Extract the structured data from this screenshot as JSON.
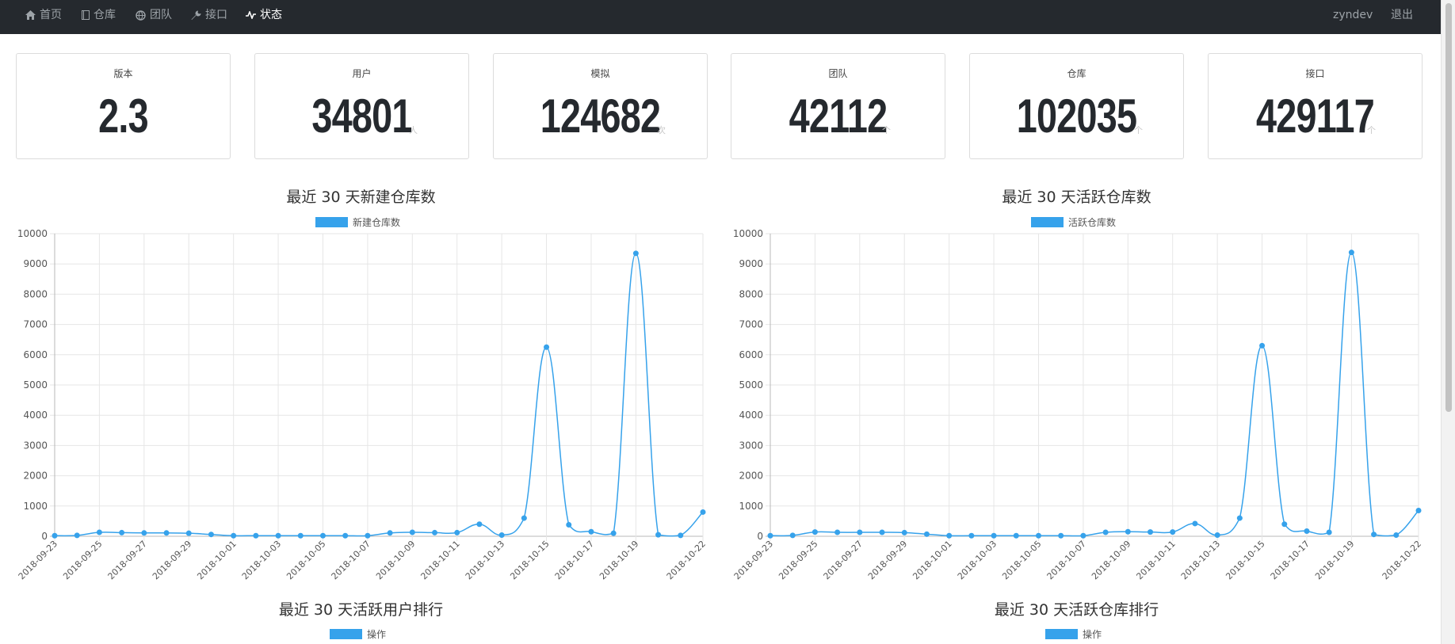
{
  "nav": {
    "items": [
      {
        "label": "首页",
        "icon": "home-icon"
      },
      {
        "label": "仓库",
        "icon": "book-icon"
      },
      {
        "label": "团队",
        "icon": "globe-icon"
      },
      {
        "label": "接口",
        "icon": "wrench-icon"
      },
      {
        "label": "状态",
        "icon": "pulse-icon",
        "active": true
      }
    ],
    "user": "zyndev",
    "logout": "退出"
  },
  "stats": [
    {
      "label": "版本",
      "value": "2.3",
      "unit": ""
    },
    {
      "label": "用户",
      "value": "34801",
      "unit": "人"
    },
    {
      "label": "模拟",
      "value": "124682",
      "unit": "次"
    },
    {
      "label": "团队",
      "value": "42112",
      "unit": "个"
    },
    {
      "label": "仓库",
      "value": "102035",
      "unit": "个"
    },
    {
      "label": "接口",
      "value": "429117",
      "unit": "个"
    }
  ],
  "bottom": {
    "left_title": "最近 30 天活跃用户排行",
    "right_title": "最近 30 天活跃仓库排行",
    "legend": "操作"
  },
  "chart_data": [
    {
      "type": "line",
      "title": "最近 30 天新建仓库数",
      "ylim": [
        0,
        10000
      ],
      "yticks": [
        0,
        1000,
        2000,
        3000,
        4000,
        5000,
        6000,
        7000,
        8000,
        9000,
        10000
      ],
      "x": [
        "2018-09-23",
        "2018-09-24",
        "2018-09-25",
        "2018-09-26",
        "2018-09-27",
        "2018-09-28",
        "2018-09-29",
        "2018-09-30",
        "2018-10-01",
        "2018-10-02",
        "2018-10-03",
        "2018-10-04",
        "2018-10-05",
        "2018-10-06",
        "2018-10-07",
        "2018-10-08",
        "2018-10-09",
        "2018-10-10",
        "2018-10-11",
        "2018-10-12",
        "2018-10-13",
        "2018-10-14",
        "2018-10-15",
        "2018-10-16",
        "2018-10-17",
        "2018-10-18",
        "2018-10-19",
        "2018-10-20",
        "2018-10-21",
        "2018-10-22"
      ],
      "xticks": [
        "2018-09-23",
        "2018-09-25",
        "2018-09-27",
        "2018-09-29",
        "2018-10-01",
        "2018-10-03",
        "2018-10-05",
        "2018-10-07",
        "2018-10-09",
        "2018-10-11",
        "2018-10-13",
        "2018-10-15",
        "2018-10-17",
        "2018-10-19",
        "2018-10-22"
      ],
      "grid": true,
      "legend_position": "top",
      "series": [
        {
          "name": "新建仓库数",
          "color": "#36a2eb",
          "values": [
            20,
            30,
            130,
            120,
            110,
            110,
            100,
            60,
            20,
            20,
            20,
            20,
            20,
            20,
            20,
            110,
            130,
            120,
            120,
            400,
            40,
            600,
            6250,
            380,
            150,
            100,
            9350,
            50,
            30,
            800
          ]
        }
      ]
    },
    {
      "type": "line",
      "title": "最近 30 天活跃仓库数",
      "ylim": [
        0,
        10000
      ],
      "yticks": [
        0,
        1000,
        2000,
        3000,
        4000,
        5000,
        6000,
        7000,
        8000,
        9000,
        10000
      ],
      "x": [
        "2018-09-23",
        "2018-09-24",
        "2018-09-25",
        "2018-09-26",
        "2018-09-27",
        "2018-09-28",
        "2018-09-29",
        "2018-09-30",
        "2018-10-01",
        "2018-10-02",
        "2018-10-03",
        "2018-10-04",
        "2018-10-05",
        "2018-10-06",
        "2018-10-07",
        "2018-10-08",
        "2018-10-09",
        "2018-10-10",
        "2018-10-11",
        "2018-10-12",
        "2018-10-13",
        "2018-10-14",
        "2018-10-15",
        "2018-10-16",
        "2018-10-17",
        "2018-10-18",
        "2018-10-19",
        "2018-10-20",
        "2018-10-21",
        "2018-10-22"
      ],
      "xticks": [
        "2018-09-23",
        "2018-09-25",
        "2018-09-27",
        "2018-09-29",
        "2018-10-01",
        "2018-10-03",
        "2018-10-05",
        "2018-10-07",
        "2018-10-09",
        "2018-10-11",
        "2018-10-13",
        "2018-10-15",
        "2018-10-17",
        "2018-10-19",
        "2018-10-22"
      ],
      "grid": true,
      "legend_position": "top",
      "series": [
        {
          "name": "活跃仓库数",
          "color": "#36a2eb",
          "values": [
            20,
            30,
            140,
            130,
            130,
            130,
            120,
            70,
            20,
            20,
            20,
            20,
            20,
            20,
            20,
            130,
            150,
            140,
            140,
            420,
            40,
            600,
            6300,
            400,
            170,
            130,
            9380,
            60,
            40,
            850
          ]
        }
      ]
    }
  ]
}
